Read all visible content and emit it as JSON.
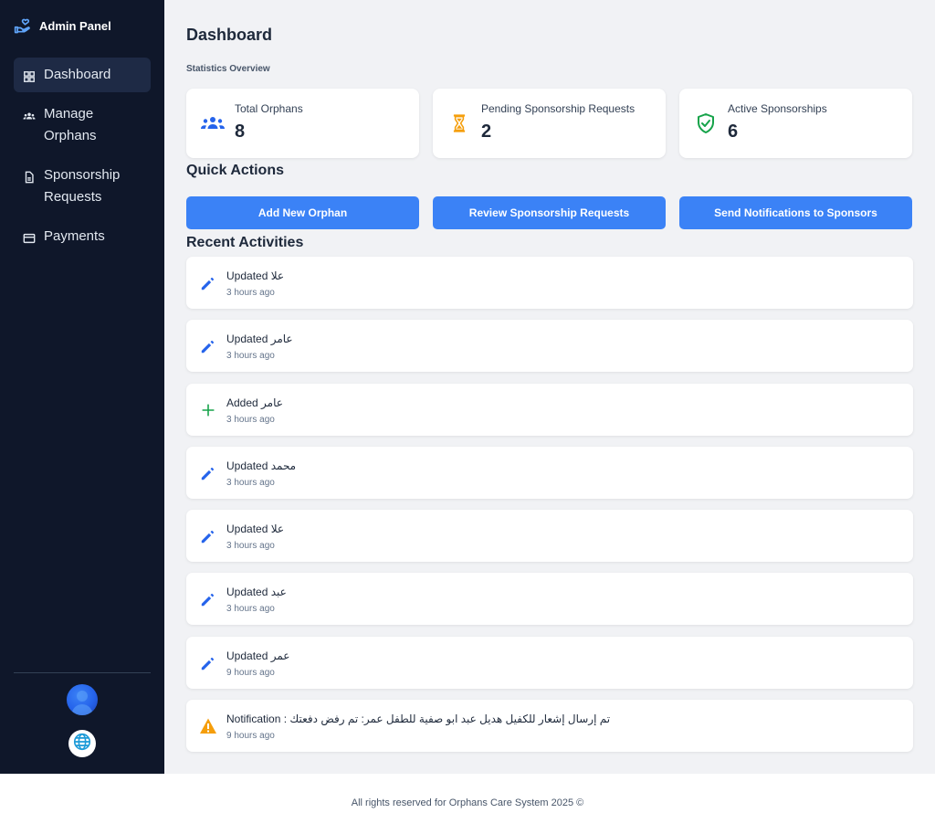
{
  "sidebar": {
    "brand": "Admin Panel",
    "brand_icon": "hand-heart-icon",
    "items": [
      {
        "label": "Dashboard",
        "icon": "grid-icon",
        "active": true
      },
      {
        "label": "Manage Orphans",
        "icon": "people-icon",
        "active": false
      },
      {
        "label": "Sponsorship Requests",
        "icon": "document-icon",
        "active": false
      },
      {
        "label": "Payments",
        "icon": "credit-card-icon",
        "active": false
      }
    ],
    "avatar_icon": "user-avatar",
    "language_icon": "globe-icon"
  },
  "main": {
    "title": "Dashboard",
    "stats_title": "Statistics Overview",
    "stats": [
      {
        "label": "Total Orphans",
        "value": "8",
        "icon": "people-icon",
        "color": "#2563eb"
      },
      {
        "label": "Pending Sponsorship Requests",
        "value": "2",
        "icon": "hourglass-icon",
        "color": "#f59e0b"
      },
      {
        "label": "Active Sponsorships",
        "value": "6",
        "icon": "shield-check-icon",
        "color": "#16a34a"
      }
    ],
    "quick_actions_title": "Quick Actions",
    "quick_actions": [
      {
        "label": "Add New Orphan"
      },
      {
        "label": "Review Sponsorship Requests"
      },
      {
        "label": "Send Notifications to Sponsors"
      }
    ],
    "recent_title": "Recent Activities",
    "activities": [
      {
        "text": "Updated علا",
        "time": "3 hours ago",
        "icon": "pencil-icon",
        "color": "#2563eb"
      },
      {
        "text": "Updated عامر",
        "time": "3 hours ago",
        "icon": "pencil-icon",
        "color": "#2563eb"
      },
      {
        "text": "Added عامر",
        "time": "3 hours ago",
        "icon": "plus-icon",
        "color": "#16a34a"
      },
      {
        "text": "Updated محمد",
        "time": "3 hours ago",
        "icon": "pencil-icon",
        "color": "#2563eb"
      },
      {
        "text": "Updated علا",
        "time": "3 hours ago",
        "icon": "pencil-icon",
        "color": "#2563eb"
      },
      {
        "text": "Updated عبد",
        "time": "3 hours ago",
        "icon": "pencil-icon",
        "color": "#2563eb"
      },
      {
        "text": "Updated عمر",
        "time": "9 hours ago",
        "icon": "pencil-icon",
        "color": "#2563eb"
      },
      {
        "text": "Notification : تم إرسال إشعار للكفيل هديل عبد ابو صفية للطفل عمر: تم رفض دفعتك",
        "time": "9 hours ago",
        "icon": "warning-icon",
        "color": "#f59e0b"
      }
    ]
  },
  "footer": {
    "text": "All rights reserved for Orphans Care System 2025 ©"
  },
  "colors": {
    "sidebar_bg": "#0f172a",
    "accent": "#3b82f6",
    "page_bg": "#f1f2f5"
  }
}
